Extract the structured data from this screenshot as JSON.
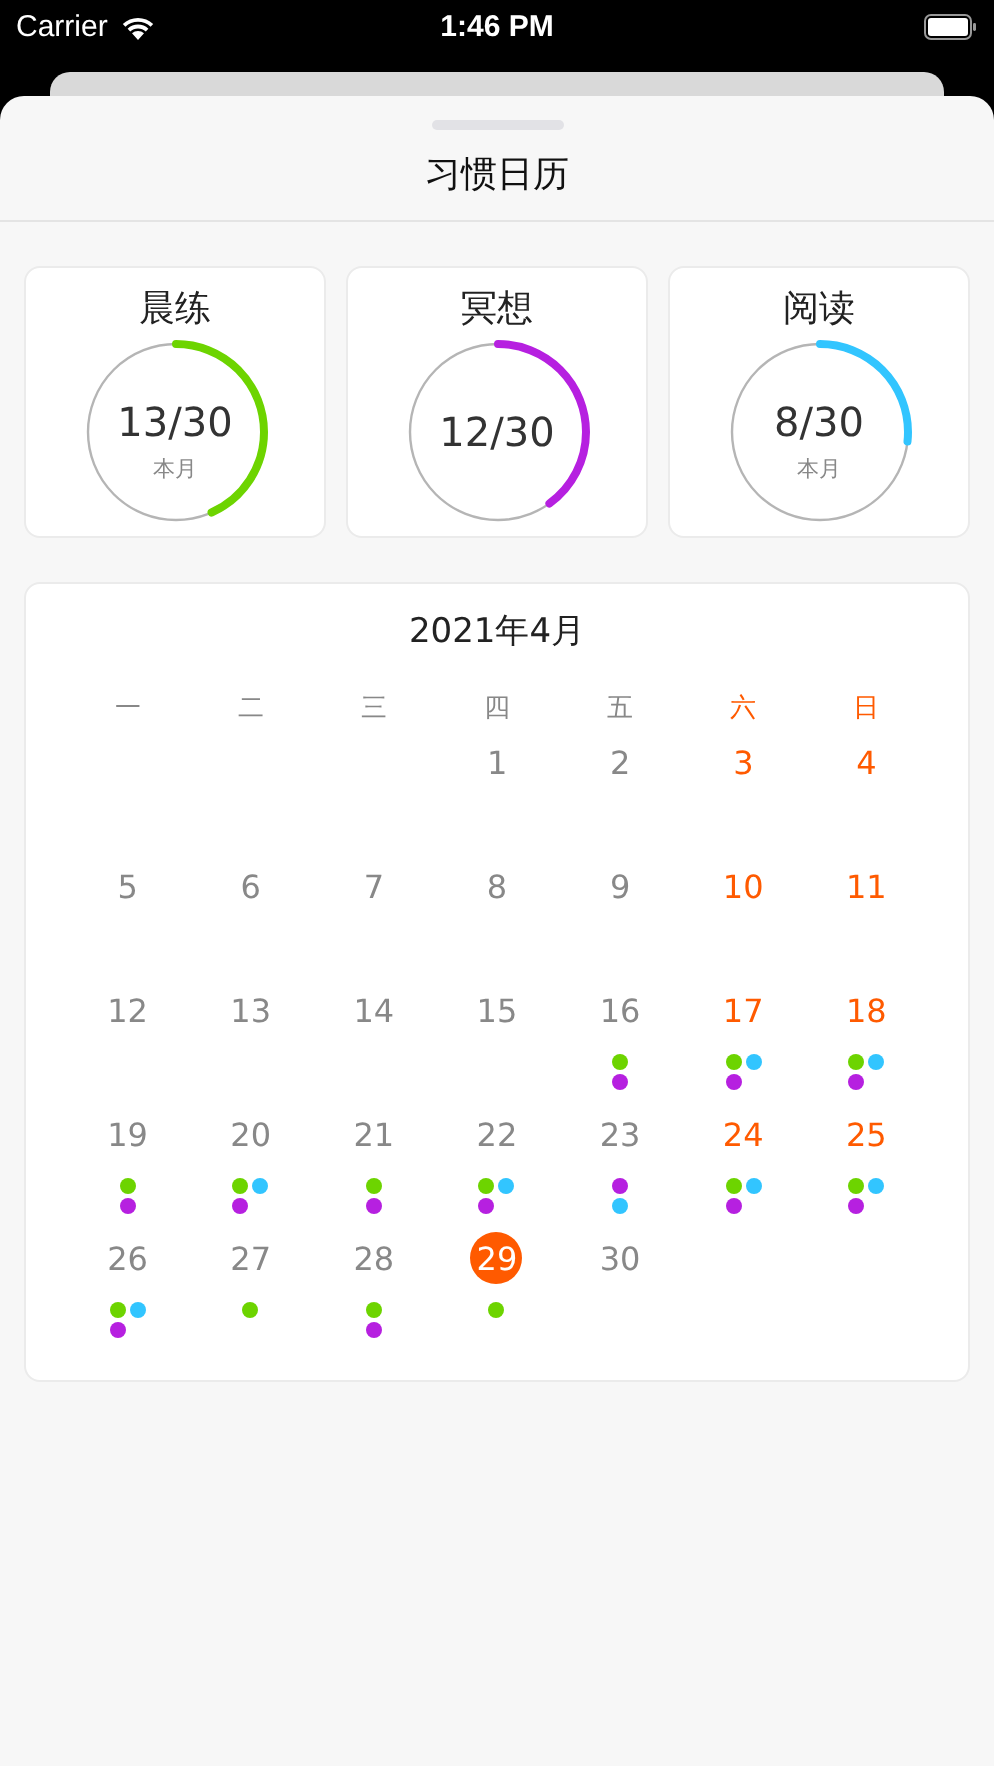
{
  "status_bar": {
    "carrier": "Carrier",
    "time": "1:46 PM"
  },
  "sheet": {
    "title": "习惯日历"
  },
  "habits": [
    {
      "name": "晨练",
      "count": "13/30",
      "caption": "本月",
      "level": 0.433,
      "color": "#6dd400"
    },
    {
      "name": "冥想",
      "count": "12/30",
      "level": 0.4,
      "color": "#b620e0"
    },
    {
      "name": "阅读",
      "count": "8/30",
      "caption": "本月",
      "level": 0.267,
      "color": "#32c5ff"
    }
  ],
  "calendar": {
    "month": "2021年4月",
    "weekdays": [
      {
        "label": "一",
        "weekend": false
      },
      {
        "label": "二",
        "weekend": false
      },
      {
        "label": "三",
        "weekend": false
      },
      {
        "label": "四",
        "weekend": false
      },
      {
        "label": "五",
        "weekend": false
      },
      {
        "label": "六",
        "weekend": true
      },
      {
        "label": "日",
        "weekend": true
      }
    ],
    "weeks": [
      {
        "days": [
          {
            "label": "1",
            "weekend": false,
            "today": false
          },
          {
            "label": "2",
            "weekend": false,
            "today": false
          },
          {
            "label": "3",
            "weekend": true,
            "today": false
          },
          {
            "label": "4",
            "weekend": true,
            "today": false
          }
        ]
      },
      {
        "days": [
          {
            "label": "5",
            "weekend": false,
            "today": false
          },
          {
            "label": "6",
            "weekend": false,
            "today": false
          },
          {
            "label": "7",
            "weekend": false,
            "today": false
          },
          {
            "label": "8",
            "weekend": false,
            "today": false
          },
          {
            "label": "9",
            "weekend": false,
            "today": false
          },
          {
            "label": "10",
            "weekend": true,
            "today": false
          },
          {
            "label": "11",
            "weekend": true,
            "today": false
          }
        ]
      },
      {
        "days": [
          {
            "label": "12",
            "weekend": false,
            "today": false
          },
          {
            "label": "13",
            "weekend": false,
            "today": false
          },
          {
            "label": "14",
            "weekend": false,
            "today": false
          },
          {
            "label": "15",
            "weekend": false,
            "today": false
          },
          {
            "label": "16",
            "weekend": false,
            "today": false,
            "dot_rows": [
              {
                "dots": [
                  {
                    "color": "#6dd400"
                  }
                ]
              },
              {
                "dots": [
                  {
                    "color": "#b620e0"
                  }
                ]
              }
            ]
          },
          {
            "label": "17",
            "weekend": true,
            "today": false,
            "dot_rows": [
              {
                "dots": [
                  {
                    "color": "#6dd400"
                  },
                  {
                    "color": "#32c5ff"
                  }
                ]
              },
              {
                "dots": [
                  {
                    "color": "#b620e0"
                  }
                ]
              }
            ]
          },
          {
            "label": "18",
            "weekend": true,
            "today": false,
            "dot_rows": [
              {
                "dots": [
                  {
                    "color": "#6dd400"
                  },
                  {
                    "color": "#32c5ff"
                  }
                ]
              },
              {
                "dots": [
                  {
                    "color": "#b620e0"
                  }
                ]
              }
            ]
          }
        ]
      },
      {
        "days": [
          {
            "label": "19",
            "weekend": false,
            "today": false,
            "dot_rows": [
              {
                "dots": [
                  {
                    "color": "#6dd400"
                  }
                ]
              },
              {
                "dots": [
                  {
                    "color": "#b620e0"
                  }
                ]
              }
            ]
          },
          {
            "label": "20",
            "weekend": false,
            "today": false,
            "dot_rows": [
              {
                "dots": [
                  {
                    "color": "#6dd400"
                  },
                  {
                    "color": "#32c5ff"
                  }
                ]
              },
              {
                "dots": [
                  {
                    "color": "#b620e0"
                  }
                ]
              }
            ]
          },
          {
            "label": "21",
            "weekend": false,
            "today": false,
            "dot_rows": [
              {
                "dots": [
                  {
                    "color": "#6dd400"
                  }
                ]
              },
              {
                "dots": [
                  {
                    "color": "#b620e0"
                  }
                ]
              }
            ]
          },
          {
            "label": "22",
            "weekend": false,
            "today": false,
            "dot_rows": [
              {
                "dots": [
                  {
                    "color": "#6dd400"
                  },
                  {
                    "color": "#32c5ff"
                  }
                ]
              },
              {
                "dots": [
                  {
                    "color": "#b620e0"
                  }
                ]
              }
            ]
          },
          {
            "label": "23",
            "weekend": false,
            "today": false,
            "dot_rows": [
              {
                "dots": [
                  {
                    "color": "#b620e0"
                  }
                ]
              },
              {
                "dots": [
                  {
                    "color": "#32c5ff"
                  }
                ]
              }
            ]
          },
          {
            "label": "24",
            "weekend": true,
            "today": false,
            "dot_rows": [
              {
                "dots": [
                  {
                    "color": "#6dd400"
                  },
                  {
                    "color": "#32c5ff"
                  }
                ]
              },
              {
                "dots": [
                  {
                    "color": "#b620e0"
                  }
                ]
              }
            ]
          },
          {
            "label": "25",
            "weekend": true,
            "today": false,
            "dot_rows": [
              {
                "dots": [
                  {
                    "color": "#6dd400"
                  },
                  {
                    "color": "#32c5ff"
                  }
                ]
              },
              {
                "dots": [
                  {
                    "color": "#b620e0"
                  }
                ]
              }
            ]
          }
        ]
      },
      {
        "days": [
          {
            "label": "26",
            "weekend": false,
            "today": false,
            "dot_rows": [
              {
                "dots": [
                  {
                    "color": "#6dd400"
                  },
                  {
                    "color": "#32c5ff"
                  }
                ]
              },
              {
                "dots": [
                  {
                    "color": "#b620e0"
                  }
                ]
              }
            ]
          },
          {
            "label": "27",
            "weekend": false,
            "today": false,
            "dot_rows": [
              {
                "dots": [
                  {
                    "color": "#6dd400"
                  }
                ]
              }
            ]
          },
          {
            "label": "28",
            "weekend": false,
            "today": false,
            "dot_rows": [
              {
                "dots": [
                  {
                    "color": "#6dd400"
                  }
                ]
              },
              {
                "dots": [
                  {
                    "color": "#b620e0"
                  }
                ]
              }
            ]
          },
          {
            "label": "29",
            "weekend": false,
            "today": true,
            "dot_rows": [
              {
                "dots": [
                  {
                    "color": "#6dd400"
                  }
                ]
              }
            ]
          },
          {
            "label": "30",
            "weekend": false,
            "today": false
          }
        ]
      }
    ]
  }
}
